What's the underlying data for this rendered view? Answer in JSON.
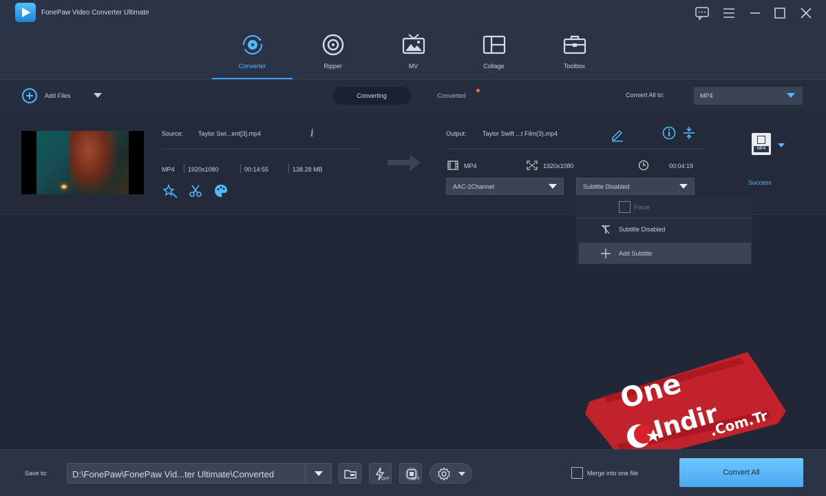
{
  "app": {
    "title": "FonePaw Video Converter Ultimate"
  },
  "nav": {
    "tabs": [
      {
        "label": "Converter",
        "icon": "converter-icon",
        "active": true
      },
      {
        "label": "Ripper",
        "icon": "disc-icon"
      },
      {
        "label": "MV",
        "icon": "tv-icon"
      },
      {
        "label": "Collage",
        "icon": "collage-icon"
      },
      {
        "label": "Toolbox",
        "icon": "toolbox-icon"
      }
    ]
  },
  "toolbar": {
    "add_files": "Add Files",
    "converting": "Converting",
    "converted": "Converted",
    "convert_all_to": "Convert All to:",
    "format": "MP4"
  },
  "file": {
    "source_label": "Source:",
    "source_name": "Taylor Swi...ent[3].mp4",
    "format": "MP4",
    "resolution": "1920x1080",
    "duration": "00:14:55",
    "size": "138.28 MB",
    "output_label": "Output:",
    "output_name": "Taylor Swift ...t Film(3).mp4",
    "out_format": "MP4",
    "out_resolution": "1920x1080",
    "out_duration": "00:04:19",
    "audio": "AAC-2Channel",
    "subtitle": "Subtitle Disabled",
    "profile_tag": "MP4",
    "status": "Success"
  },
  "subtitle_menu": {
    "force": "Force",
    "items": [
      {
        "label": "Subtitle Disabled",
        "icon": "text-off-icon"
      },
      {
        "label": "Add Subtitle",
        "icon": "plus-icon"
      }
    ]
  },
  "watermark": {
    "line1": "One",
    "line2": "Indir",
    "line3": ".Com.Tr"
  },
  "bottom": {
    "save_to": "Save to:",
    "path": "D:\\FonePaw\\FonePaw Vid...ter Ultimate\\Converted",
    "off1": "OFF",
    "off2": "OFF",
    "merge": "Merge into one file",
    "convert_all": "Convert All"
  },
  "colors": {
    "accent": "#4fb8ff",
    "bg": "#202838",
    "panel": "#2b3446",
    "badge": "#ff6a3d",
    "watermark": "#d8212a"
  }
}
